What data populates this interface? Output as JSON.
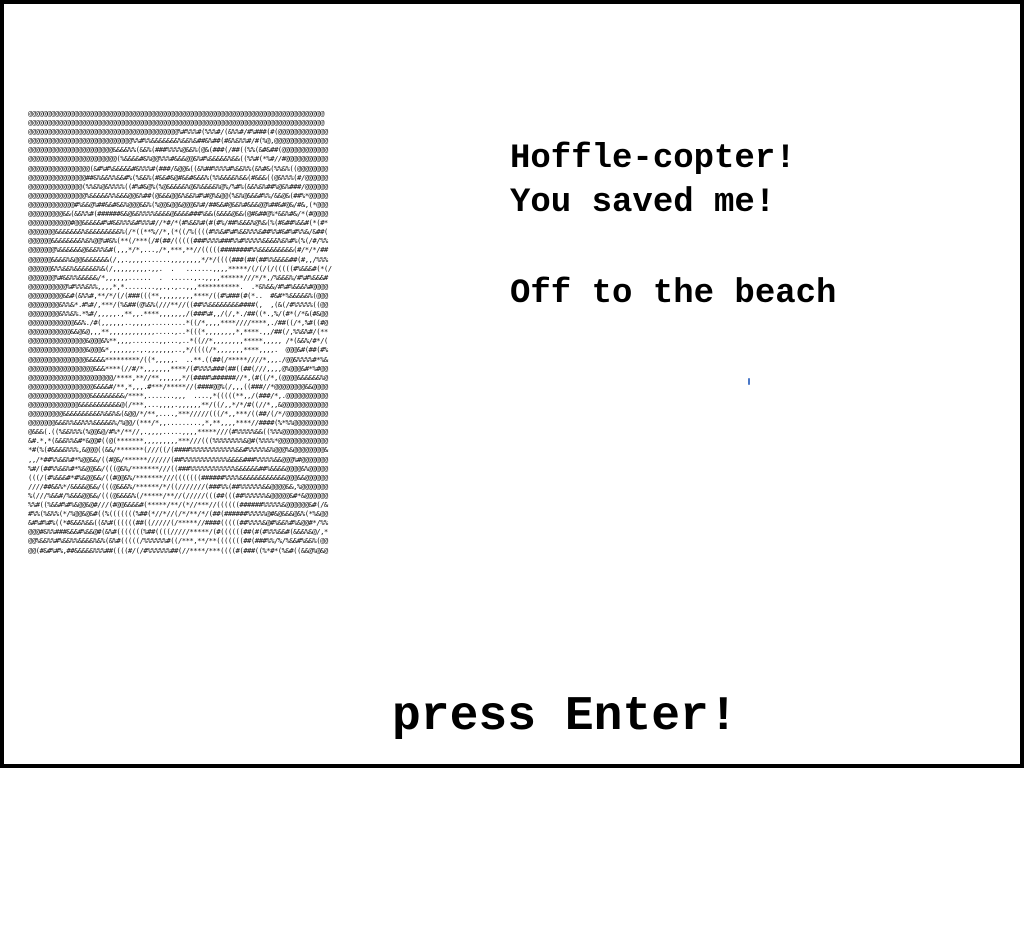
{
  "scene": {
    "dialog_lines": [
      "Hoffle-copter!",
      "You saved me!",
      "Off to the beach"
    ],
    "prompt": "press Enter!",
    "ascii_art_rows": [
      "@@@@@@@@@@@@@@@@@@@@@@@@@@@@@@@@@@@@@@@@@@@@@@@@@@@@@@@@@@@@@@@@@@@@@@@@@@@@@",
      "@@@@@@@@@@@@@@@@@@@@@@@@@@@@@@@@@@@@@@@@@@@@@@@@@@@@@@@@@@@@@@@@@@@@@@@@@@@@@",
      "@@@@@@@@@@@@@@@@@@@@@@@@@@@@@@@@@@@@@@@%#%%%#(%%%#/(&%%#/#%###(#(@@@@@@@@@@@@@",
      "@@@@@@@@@@@@@@@@@@@@@@@@@@@%%#%%&&&&&&&%&&%&##&%##(#&%&%%#/#(%@,@@@@@@@@@@@@@@",
      "@@@@@@@@@@@@@@@@@@@@@@&&&&%%(&&%(###%%%%@&&%(@&(###(/##((%%(&#&##(@@@@@@@@@@@@",
      "@@@@@@@@@@@@@@@@@@@@@@@(%&&&&#&%@@%%%#&&&@@&%#%&&&&&%&&((%%#(*%#//#@@@@@@@@@@@",
      "@@@@@@@@@@@@@@@@(&#%#%&&&&&#&%%%#(###/&@@&((&%##%%%%#%&&%%(&%#&(%%&%((@@@@@@@@",
      "@@@@@@@@@@@@@@@##&%&&%%&&#%(%&&%(#&&#&@#&&#&&&%(%%&&&&%&&(#&&&((@&%%%(#/@@@@@@",
      "@@@@@@@@@@@@@@(%%&%@&%%%%((#%#&@%(%@&&&&&%@&%&&&&%@%/%#%(&&%&%##%@&%###/@@@@@@",
      "@@@@@@@@@@@@@@@%&&&&&%%&&&@@&%##(@&&&@@&%&&%#%#@%&@@(%&%@&&&#%%/&&@&(##%*@@@@@",
      "@@@@@@@@@@@@#%&&@%##&&#&&%@@@&&%(%@@&@@&@@@&%#/##&&#@&&%#&&&@@%##&#@&/#&,(*@@@",
      "@@@@@@@@@&&(&&%%#(######&&@&&%%%%&&&&@&&&&###%&&(&&&&@&&(@#&##@%*&&%#&/*(#@@@@",
      "@@@@@@@@@@@#@@&&&&&#%#&&%%%&#%%%#//*#/*(#%&&%#(#(#%/##%&&&%@%&(%(#&##%&&#(*(#*",
      "@@@@@@@&&&&&&&%&&&&&&&&&%(/*((**%//*,(*((/%((((#%%&#%#%&&%%%&##%%#&#%#%%&/&##(",
      "@@@@@@&&&&&&&&%&%@@%#&%(**(/***(/#(##/(((((###%%%%###%%#%%%%%&&&&%&%#%(%(/#/%%",
      "@@@@@@@%&&&&&&@&&&%%&#(,,,*/*,...,/*,***,**//(((((########%%&&&&&&&&&(#/*/*/##",
      "@@@@@@&&&&%&@@&&&&&&&(/,,.,,,,.......,,,,,,,,*/*/((((###(##(##%%&&&&##(#,,/%%%",
      "@@@@@@&%%&&%&&&&&&%&(/,,,,,,,,,.,,.  .   .......,,,,*****/(/(/(/(((((#%&&&#(*(/",
      "@@@@@@@%#&&%%&&&&&/*,,,,,,......  .  ......,..,,,,******///*/*,/%&&&%/#%#%&&&#",
      "@@@@@@@@@@%#%%%&%%,,,,*,*........,,.,.,..,,,***********.  .*&%&&/#%#%&&&%#@@@@",
      "@@@@@@@@@&&#(&%%#,**/*/(/(###(((**,,,,,,,,,****/((#%###(#(*..  #&#*%&&&&&%(@@@",
      "@@@@@@@@&%%&*.#%#/,***/(%&##(@%&%(///**//((##%%&&&&&&&&####(,  ,(&(/#%%%%%((@@",
      "@@@@@@@@&%%&%.*%#/,,,,,.,**,,.****,,,,,,,/(###%#,,/(/,*./##((*.,%/(#*(/*&(#&@@",
      "@@@@@@@@@@@@&&%./#(,,,,,,..,,,,,.........*((/*,,,,****////****,./##((/*,%#((#@",
      "@@@@@@@@@@@&&@&@,,,**,,,,,,,,,,,,.....,..*(((*,,,,,,,,*,****.,,/##(/,%%&%#/(**",
      "@@@@@@@@@@@@@@@&@@@&%**,,,,.......,,...,..*((//*,,,,,,,,*****,,,,, /*(&&%/#*/(",
      "@@@@@@@@@@@@@@@&@@@&*,,,,,,,.,.,,,,,,,..,*/((((/*,,,,,,,****,,,,.  @@@&#(##(#%",
      "@@@@@@@@@@@@@@@&&&&&*********/((*,,,,,.  ..**.((##(/*****////*,,,./@@&%%%%#*%&",
      "@@@@@@@@@@@@@@@@@&&&****(//#/*,,,,,,,****/(#%%%%###(##((##(///,,,,@%@@@&#*%#@@",
      "@@@@@@@@@@@@@@@@@@@@@@/****,**//**,,,,,,*/(####%######//*,(#((/*,(@@@@&&&&&&%@",
      "@@@@@@@@@@@@@@@@@&&&&#/**,*,,,.#***/*****//(####@@%(/,,,((###//*@@@@@@@@&&@@@@",
      "@@@@@@@@@@@@@@@@&&&&&&&&&/****,.......,,,  ....,*(((((**,,/(###/*,.@@@@@@@@@@@",
      "@@@@@@@@@@@@@&&&&&&&&&&&@(/***,...,,,,.,,,,,,**/((/,,*/*/#((//*,,&@@@@@@@@@@@@",
      "@@@@@@@@@&&&&&&&&&&%&&%&(&@@/*/**,....,***/////(((/*,,***/((##/(/*/@@@@@@@@@@@",
      "@@@@@@@&&&%%&&%%%&&&&&%/%@@/(***/*,,.........,*,**,,,,****//####(%*%%@@@@@@@@@",
      "@&&&(.((%&&%%%(%@@&@/#%*/**//,.,,,,.....,,,,*****///(#%%%%%&&((%%%@@@@@@@@@@@@",
      "&#.*,*(&&&%%&#*&@@#((@(*******,,,,,,,,,***///(((%%%%%%%%&@#(%%%%*@@@@@@@@@@@@@",
      "*#(%(#&&&&%%%,&@@@((&&/*******(///((/(####%%%%%%%%%%%%&&#%%%%%&%@@@%&@@@@@@@@&",
      ",,/*##%%&&%#*%@@&&/((#@&/******//////(##%%%%%%%%%%%%&&&&###%%%%%&&@@@%#@@@@@@@",
      "%#/(##%%&&%#*%&@@&&/(((@&%/*******///((###%%%%%%%%%%%%&&&&&&##%&&&&@@@@&%@@@@@",
      "(((/(#%&&&#*#%&@@&&/((#@@&%/*******///(((((((######%%%%&&&&&&&&&&&&@@@&&@@@@@@",
      "////##&&%*/&&&&@&&/(((@&&&%/******/*/((///////(###%%(##%%%%%%&&@@@@&&,%@@@@@@@",
      "%(///%&&#/%&&&@@&&/(((@&&&&%(/*****/**//(/////(((##(((##%%%%%%&@@@@@&#*&@@@@@@",
      "%%#((%&&#%#%&@@&@#///(#@@&&&&#(*****/**/(*//***//((((((######%%%%%&@@@@@@&#(/&",
      "#%%(%&%%(*/%@@&@&#((%(((((((%##(*//*//(/*/**/*/(##(######%%%%%@#&@&&&@&%(*%&@@",
      "&#%#%#%((*#&&&%&&((&%#((((((##((/////(/*****//####(((((##%%%%&@#%&&%#%&@@#*/%%",
      "@@@#&%%###&&&#%&&@#(&%#(((((((%##((((/////*****/(#((((((##(#(#%%%&&#(&&&%&@/,*",
      "@@%&&%%#%&&%%&&&&%&%(&%#(((((/%%%%%%#((/***,**/**(((((((##(###%%/%/%&&#%&&%(@@",
      "@@(#&#%#%,##&&&&&%%%##((((#/(/#%%%%%%##(//****/***((((#(###((%*#*(%&#((&&@%@&@"
    ]
  }
}
